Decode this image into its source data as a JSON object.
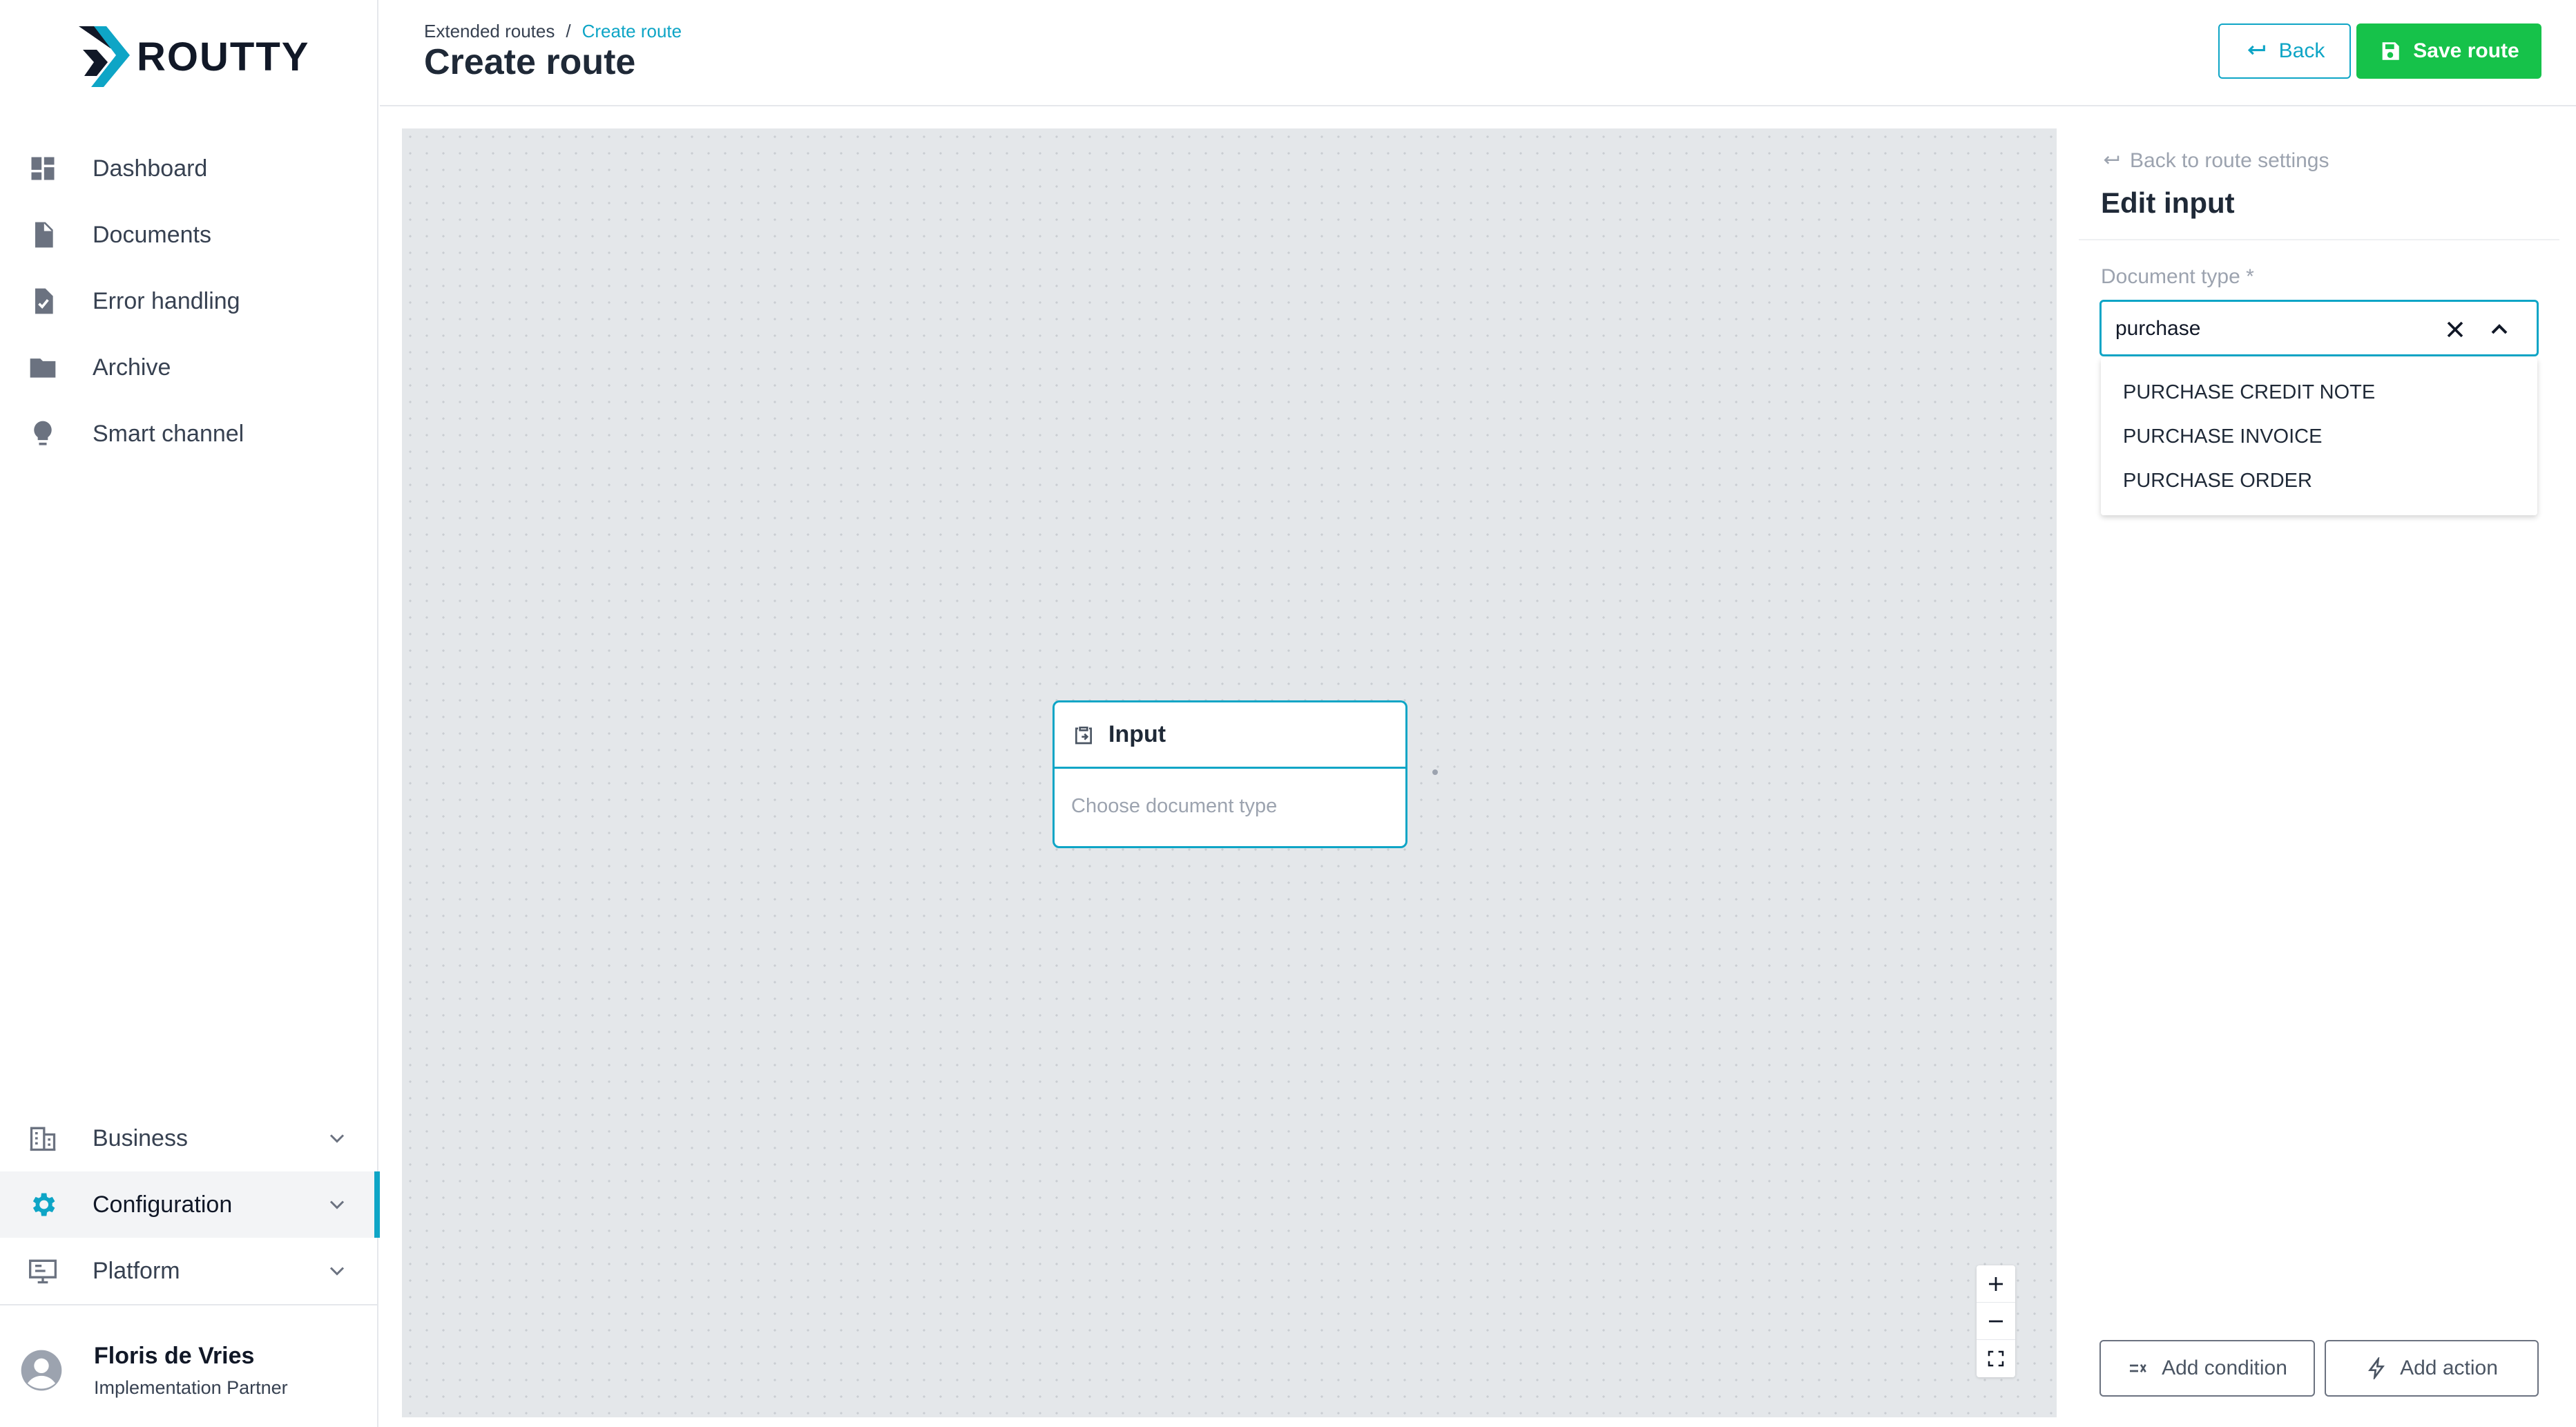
{
  "app": {
    "logo_text": "ROUTTY",
    "accent": "#0ea5c6",
    "save_color": "#16c24a"
  },
  "sidebar": {
    "items": [
      {
        "label": "Dashboard",
        "icon": "dashboard-icon"
      },
      {
        "label": "Documents",
        "icon": "document-icon"
      },
      {
        "label": "Error handling",
        "icon": "clipboard-check-icon"
      },
      {
        "label": "Archive",
        "icon": "folder-icon"
      },
      {
        "label": "Smart channel",
        "icon": "lightbulb-icon"
      }
    ],
    "groups": [
      {
        "label": "Business",
        "icon": "building-icon",
        "expanded": false
      },
      {
        "label": "Configuration",
        "icon": "gear-icon",
        "expanded": false,
        "active": true
      },
      {
        "label": "Platform",
        "icon": "platform-icon",
        "expanded": false
      }
    ],
    "user": {
      "name": "Floris de Vries",
      "role": "Implementation Partner"
    }
  },
  "header": {
    "breadcrumb": {
      "parent": "Extended routes",
      "separator": "/",
      "current": "Create route"
    },
    "title": "Create route",
    "back_label": "Back",
    "save_label": "Save route"
  },
  "canvas": {
    "node": {
      "title": "Input",
      "placeholder": "Choose document type",
      "icon": "clipboard-icon"
    },
    "zoom_controls": [
      "zoom-in",
      "zoom-out",
      "fit-view"
    ]
  },
  "panel": {
    "back_link": "Back to route settings",
    "title": "Edit input",
    "field_label": "Document type *",
    "field_value": "purchase",
    "options": [
      "PURCHASE CREDIT NOTE",
      "PURCHASE INVOICE",
      "PURCHASE ORDER"
    ],
    "add_condition_label": "Add condition",
    "add_action_label": "Add action"
  }
}
